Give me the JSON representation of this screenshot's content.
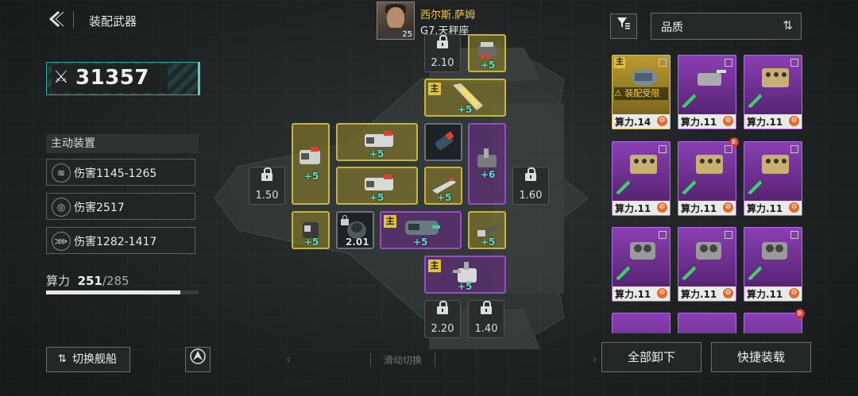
{
  "header": {
    "title": "装配武器",
    "back_icon": "chevron-left-icon"
  },
  "power": {
    "value": "31357",
    "icon": "crossed-swords-icon"
  },
  "active": {
    "title": "主动装置",
    "stats": [
      {
        "text": "伤害1145-1265",
        "icon": "claw-icon"
      },
      {
        "text": "伤害2517",
        "icon": "radar-circle-icon"
      },
      {
        "text": "伤害1282-1417",
        "icon": "missile-barrage-icon"
      }
    ]
  },
  "compute": {
    "label": "算力",
    "used": "251",
    "max": "/285",
    "fraction": 0.88
  },
  "buttons": {
    "switch_ship": "切换舰船",
    "unload_all": "全部卸下",
    "quick_equip": "快捷装载"
  },
  "captain": {
    "name": "西尔斯.萨姆",
    "level": "25",
    "subtitle": "G7.天秤座"
  },
  "slide_hint": "滑动切换",
  "slots": {
    "plus": "+5",
    "plus6": "+6",
    "main": "主",
    "locks": [
      "2.10",
      "1.50",
      "1.60",
      "2.01",
      "2.20",
      "1.40"
    ]
  },
  "panel": {
    "sort_label": "品质",
    "limit_text": "装配受限",
    "cards": [
      {
        "label": "算力.14",
        "main": "主"
      },
      {
        "label": "算力.11"
      },
      {
        "label": "算力.11"
      },
      {
        "label": "算力.11"
      },
      {
        "label": "算力.11",
        "badge": "新"
      },
      {
        "label": "算力.11"
      },
      {
        "label": "算力.11"
      },
      {
        "label": "算力.11"
      },
      {
        "label": "算力.11"
      },
      {
        "badge": "新"
      }
    ]
  },
  "colors": {
    "accent": "#5fd0c0",
    "gold": "#c9b43a",
    "purple": "#9b4bc4",
    "captain": "#f0c640"
  }
}
